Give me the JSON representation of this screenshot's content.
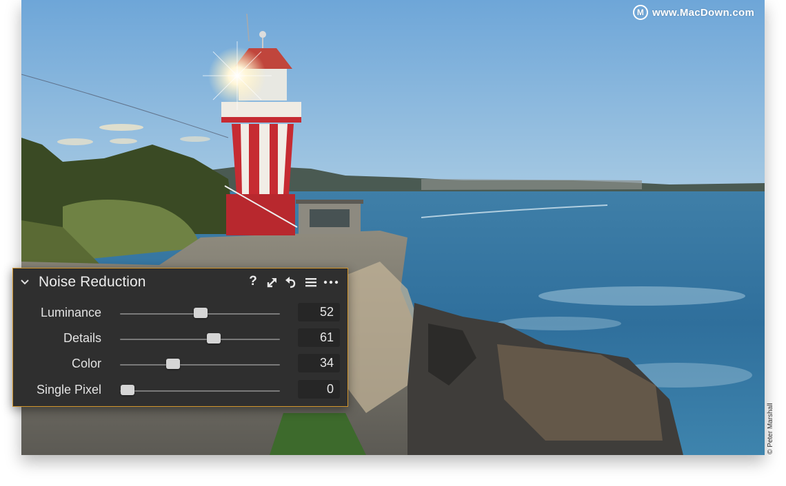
{
  "watermark": {
    "text": "www.MacDown.com",
    "logo_letter": "M"
  },
  "credit": "© Peter Marshall",
  "panel": {
    "title": "Noise Reduction",
    "header_icons": [
      "help-icon",
      "expand-icon",
      "reset-icon",
      "list-icon",
      "more-icon"
    ],
    "help_label": "?",
    "accent_color": "#d3962c",
    "sliders": [
      {
        "label": "Luminance",
        "value": "52",
        "level": 0.52
      },
      {
        "label": "Details",
        "value": "61",
        "level": 0.61
      },
      {
        "label": "Color",
        "value": "34",
        "level": 0.34
      },
      {
        "label": "Single Pixel",
        "value": "0",
        "level": 0.0
      }
    ]
  }
}
